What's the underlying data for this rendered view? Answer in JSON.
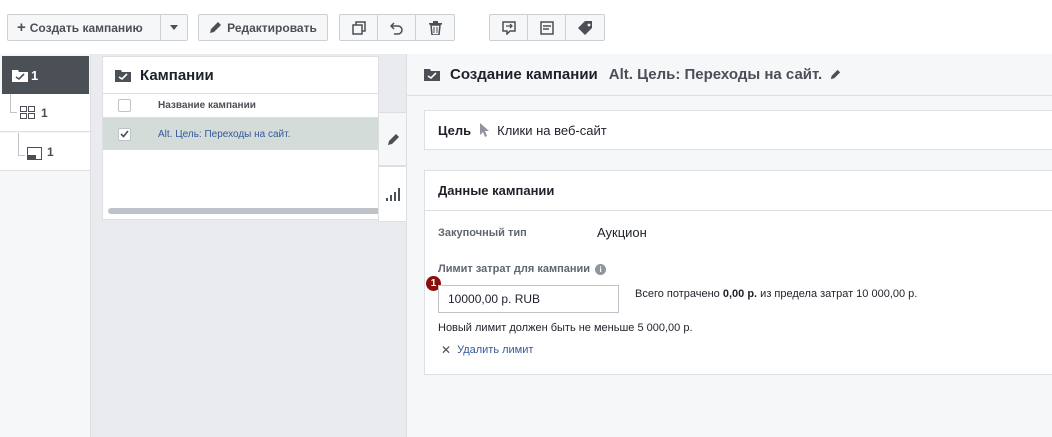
{
  "toolbar": {
    "create_label": "Создать кампанию",
    "edit_label": "Редактировать"
  },
  "tree": {
    "top_count": "1",
    "adset_count": "1",
    "ad_count": "1"
  },
  "campaigns": {
    "title": "Кампании",
    "column_name": "Название кампании",
    "rows": [
      {
        "name": "Alt. Цель: Переходы на сайт.",
        "checked": true
      }
    ]
  },
  "create": {
    "title": "Создание кампании",
    "campaign_name": "Alt. Цель: Переходы на сайт."
  },
  "goal": {
    "label": "Цель",
    "value": "Клики на веб-сайт"
  },
  "campaign_data": {
    "title": "Данные кампании",
    "buying_type_label": "Закупочный тип",
    "buying_type_value": "Аукцион",
    "limit_label": "Лимит затрат для кампании",
    "limit_value": "10000,00 р. RUB",
    "badge": "1",
    "spent_prefix": "Всего потрачено ",
    "spent_amount": "0,00 р.",
    "spent_suffix": " из предела затрат 10 000,00 р.",
    "hint": "Новый лимит должен быть не меньше 5 000,00 р.",
    "remove_label": "Удалить лимит"
  }
}
